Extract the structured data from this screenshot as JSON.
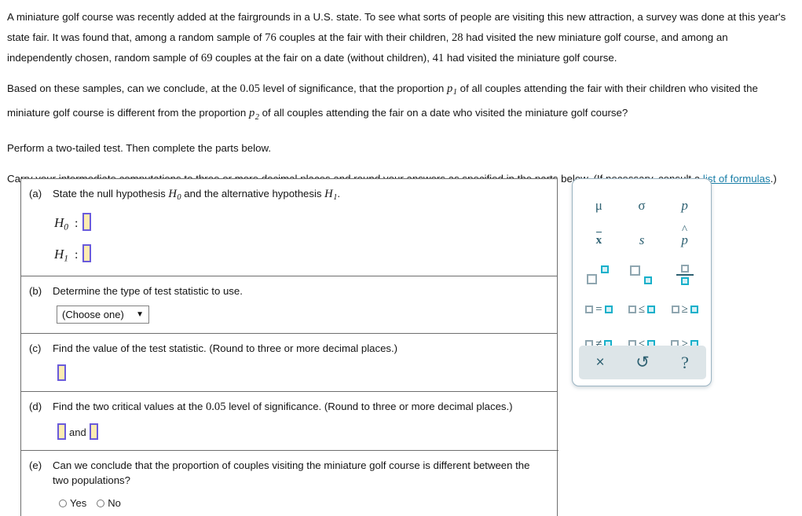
{
  "problem": {
    "paragraph1_part1": "A miniature golf course was recently added at the fairgrounds in a U.S. state. To see what sorts of people are visiting this new attraction, a survey was done at this year's state fair. It was found that, among a random sample of ",
    "sample1_n": "76",
    "paragraph1_part2": " couples at the fair with their children, ",
    "sample1_x": "28",
    "paragraph1_part3": " had visited the new miniature golf course, and among an independently chosen, random sample of ",
    "sample2_n": "69",
    "paragraph1_part4": " couples at the fair on a date (without children), ",
    "sample2_x": "41",
    "paragraph1_part5": " had visited the miniature golf course.",
    "paragraph2_part1": "Based on these samples, can we conclude, at the ",
    "alpha": "0.05",
    "paragraph2_part2": " level of significance, that the proportion ",
    "p1_base": "p",
    "p1_sub": "1",
    "paragraph2_part3": " of all couples attending the fair with their children who visited the miniature golf course is different from the proportion ",
    "p2_base": "p",
    "p2_sub": "2",
    "paragraph2_part4": " of all couples attending the fair on a date who visited the miniature golf course?",
    "paragraph3": "Perform a two-tailed test. Then complete the parts below.",
    "paragraph4_part1": "Carry your intermediate computations to three or more decimal places and round your answers as specified in the parts below. (If necessary, consult a ",
    "formulas_link": "list of formulas",
    "paragraph4_part2": ".)"
  },
  "parts": {
    "a": {
      "label": "(a)",
      "text_part1": "State the null hypothesis ",
      "h0_base": "H",
      "h0_sub": "0",
      "text_part2": " and the alternative hypothesis ",
      "h1_base": "H",
      "h1_sub": "1",
      "text_part3": ".",
      "h0_row_base": "H",
      "h0_row_sub": "0",
      "h1_row_base": "H",
      "h1_row_sub": "1",
      "colon": ":"
    },
    "b": {
      "label": "(b)",
      "text": "Determine the type of test statistic to use.",
      "select_value": "(Choose one)",
      "select_caret": "▼"
    },
    "c": {
      "label": "(c)",
      "text": "Find the value of the test statistic. (Round to three or more decimal places.)"
    },
    "d": {
      "label": "(d)",
      "text_part1": "Find the two critical values at the ",
      "alpha": "0.05",
      "text_part2": " level of significance. (Round to three or more decimal places.)",
      "and_label": "and"
    },
    "e": {
      "label": "(e)",
      "text": "Can we conclude that the proportion of couples visiting the miniature golf course is different between the two populations?",
      "option_yes": "Yes",
      "option_no": "No"
    }
  },
  "palette": {
    "row1": [
      "μ",
      "σ",
      "p"
    ],
    "row2": [
      "x",
      "s",
      "p"
    ],
    "row2_names": [
      "x-bar",
      "s",
      "p-hat"
    ],
    "row3_names": [
      "superscript-box",
      "subscript-box",
      "fraction-box"
    ],
    "relations_row1": [
      "=",
      "≤",
      "≥"
    ],
    "relations_row2": [
      "≠",
      "<",
      ">"
    ],
    "toolbar": {
      "clear": "×",
      "undo": "↺",
      "help": "?"
    }
  },
  "colors": {
    "input_fill": "#fdecb2",
    "input_border": "#6a5bdb",
    "palette_teal": "#2e6172",
    "palette_accent": "#17b0ca",
    "link": "#1a7fa8"
  }
}
